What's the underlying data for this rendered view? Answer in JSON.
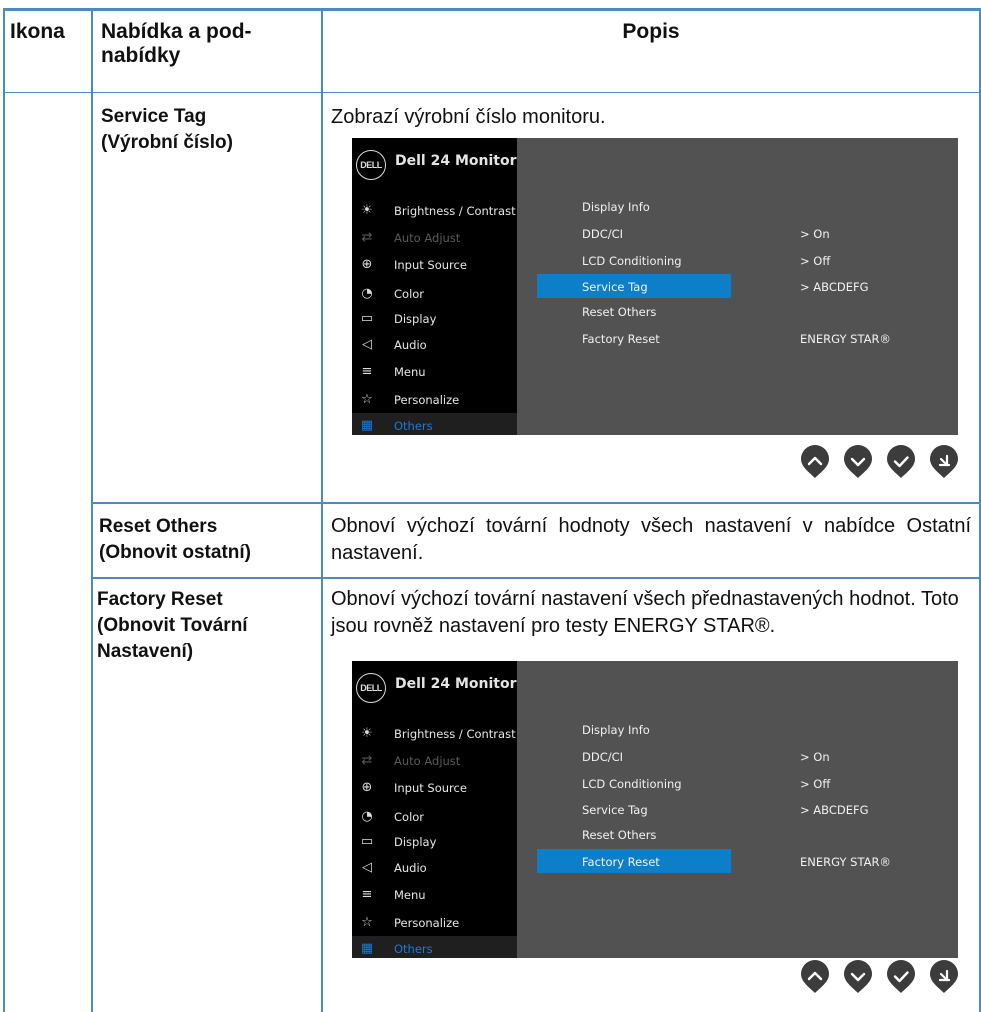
{
  "table": {
    "headers": {
      "icon": "Ikona",
      "menu": "Nabídka a pod-\nnabídky",
      "desc": "Popis"
    },
    "rows": [
      {
        "menu": "Service Tag\n(Výrobní číslo)",
        "desc": "Zobrazí výrobní číslo monitoru."
      },
      {
        "menu": "Reset Others\n(Obnovit ostatní)",
        "desc": "Obnoví výchozí tovární hodnoty všech nastavení v nabídce Ostatní nastavení."
      },
      {
        "menu": "Factory Reset\n(Obnovit Tovární\nNastavení)",
        "desc": "Obnoví výchozí tovární nastavení všech přednastavených hodnot. Toto jsou rovněž nastavení pro testy ENERGY STAR®."
      }
    ]
  },
  "osd": {
    "logo": "DELL",
    "title": "Dell 24 Monitor",
    "menu_items": [
      {
        "label": "Brightness / Contrast",
        "icon": "sun-icon"
      },
      {
        "label": "Auto Adjust",
        "icon": "auto-adjust-icon"
      },
      {
        "label": "Input Source",
        "icon": "input-source-icon"
      },
      {
        "label": "Color",
        "icon": "color-icon"
      },
      {
        "label": "Display",
        "icon": "display-icon"
      },
      {
        "label": "Audio",
        "icon": "speaker-icon"
      },
      {
        "label": "Menu",
        "icon": "menu-icon"
      },
      {
        "label": "Personalize",
        "icon": "star-icon"
      },
      {
        "label": "Others",
        "icon": "others-icon"
      }
    ],
    "submenu": [
      {
        "label": "Display Info",
        "value": ""
      },
      {
        "label": "DDC/CI",
        "value": ">   On"
      },
      {
        "label": "LCD Conditioning",
        "value": ">   Off"
      },
      {
        "label": "Service Tag",
        "value": ">   ABCDEFG"
      },
      {
        "label": "Reset Others",
        "value": ""
      },
      {
        "label": "Factory Reset",
        "value": "ENERGY STAR®"
      }
    ],
    "screens": [
      {
        "highlighted_submenu": "Service Tag"
      },
      {
        "highlighted_submenu": "Factory Reset"
      }
    ],
    "buttons": [
      "up-button",
      "down-button",
      "ok-button",
      "back-button"
    ]
  },
  "colors": {
    "table_border": "#4a8bc4",
    "osd_highlight": "#0d7fc9",
    "osd_background": "#525252"
  }
}
